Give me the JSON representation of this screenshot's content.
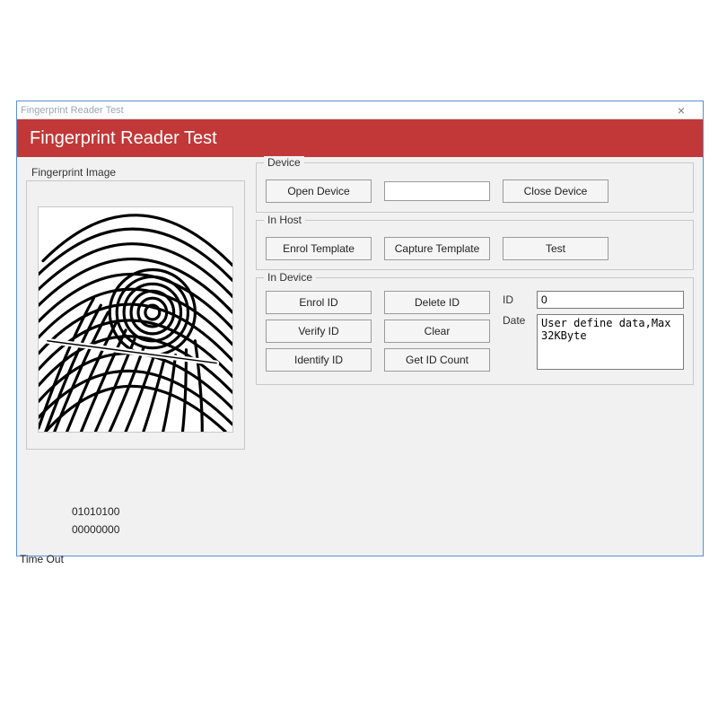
{
  "window": {
    "titlebar": "Fingerprint Reader Test",
    "close": "×",
    "banner": "Fingerprint Reader Test"
  },
  "left": {
    "title": "Fingerprint Image"
  },
  "device": {
    "label": "Device",
    "open": "Open Device",
    "status_value": "",
    "close": "Close Device"
  },
  "inhost": {
    "label": "In Host",
    "enrol": "Enrol Template",
    "capture": "Capture Template",
    "test": "Test"
  },
  "indevice": {
    "label": "In Device",
    "enrol_id": "Enrol ID",
    "delete_id": "Delete ID",
    "verify_id": "Verify ID",
    "clear": "Clear",
    "identify_id": "Identify ID",
    "get_id_count": "Get ID Count",
    "id_label": "ID",
    "id_value": "0",
    "date_label": "Date",
    "date_value": "User define data,Max 32KByte"
  },
  "status": {
    "line1": "01010100",
    "line2": "00000000",
    "timeout": "Time Out"
  }
}
